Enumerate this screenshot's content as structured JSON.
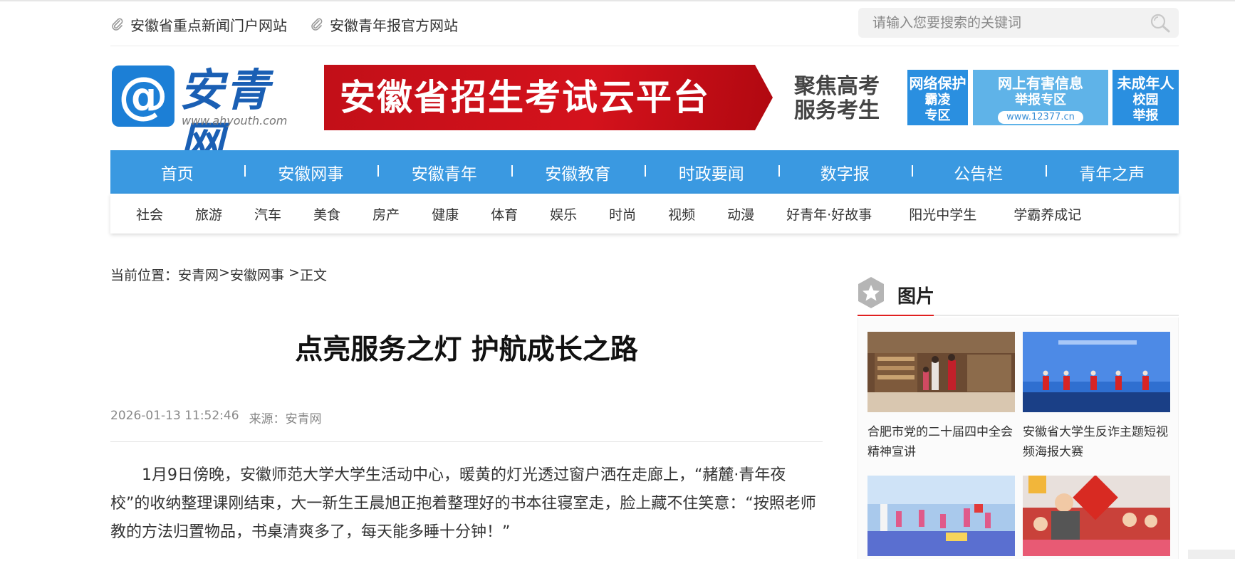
{
  "top_links": [
    {
      "label": "安徽省重点新闻门户网站",
      "icon": "paperclip-icon"
    },
    {
      "label": "安徽青年报官方网站",
      "icon": "paperclip-icon"
    }
  ],
  "search": {
    "placeholder": "请输入您要搜索的关键词",
    "icon": "search-icon"
  },
  "logo": {
    "at": "@",
    "name": "安青网",
    "url": "www.ahyouth.com"
  },
  "banners": {
    "exam_platform": {
      "title": "安徽省招生考试云平台",
      "slogan_line1": "聚焦高考",
      "slogan_line2": "服务考生"
    },
    "network_protect": {
      "line1": "网络保护",
      "line2": "霸凌",
      "line3": "专区"
    },
    "harmful_report": {
      "line1": "网上有害信息",
      "line2": "举报专区",
      "url": "www.12377.cn"
    },
    "minor_report": {
      "line1": "未成年人",
      "line2": "校园",
      "line3": "举报"
    }
  },
  "main_nav": [
    "首页",
    "安徽网事",
    "安徽青年",
    "安徽教育",
    "时政要闻",
    "数字报",
    "公告栏",
    "青年之声"
  ],
  "sub_nav": [
    "社会",
    "旅游",
    "汽车",
    "美食",
    "房产",
    "健康",
    "体育",
    "娱乐",
    "时尚",
    "视频",
    "动漫",
    "好青年·好故事",
    "阳光中学生",
    "学霸养成记"
  ],
  "breadcrumb": {
    "prefix": "当前位置：",
    "home": "安青网",
    "sep1": ">",
    "section": "安徽网事",
    "sep2": " >",
    "current": "正文"
  },
  "article": {
    "title": "点亮服务之灯 护航成长之路",
    "datetime": "2026-01-13 11:52:46",
    "source_label": "来源：",
    "source": "安青网",
    "paragraph1": "1月9日傍晚，安徽师范大学大学生活动中心，暖黄的灯光透过窗户洒在走廊上，“赭麓·青年夜校”的收纳整理课刚结束，大一新生王晨旭正抱着整理好的书本往寝室走，脸上藏不住笑意：“按照老师教的方法归置物品，书桌清爽多了，每天能多睡十分钟！”"
  },
  "sidebar": {
    "title": "图片",
    "items": [
      {
        "caption": "合肥市党的二十届四中全会精神宣讲"
      },
      {
        "caption": "安徽省大学生反诈主题短视频海报大赛"
      },
      {
        "caption": ""
      },
      {
        "caption": ""
      }
    ]
  },
  "colors": {
    "nav_blue": "#3a99e1",
    "banner_red": "#c20f18",
    "accent_red": "#e02020"
  }
}
